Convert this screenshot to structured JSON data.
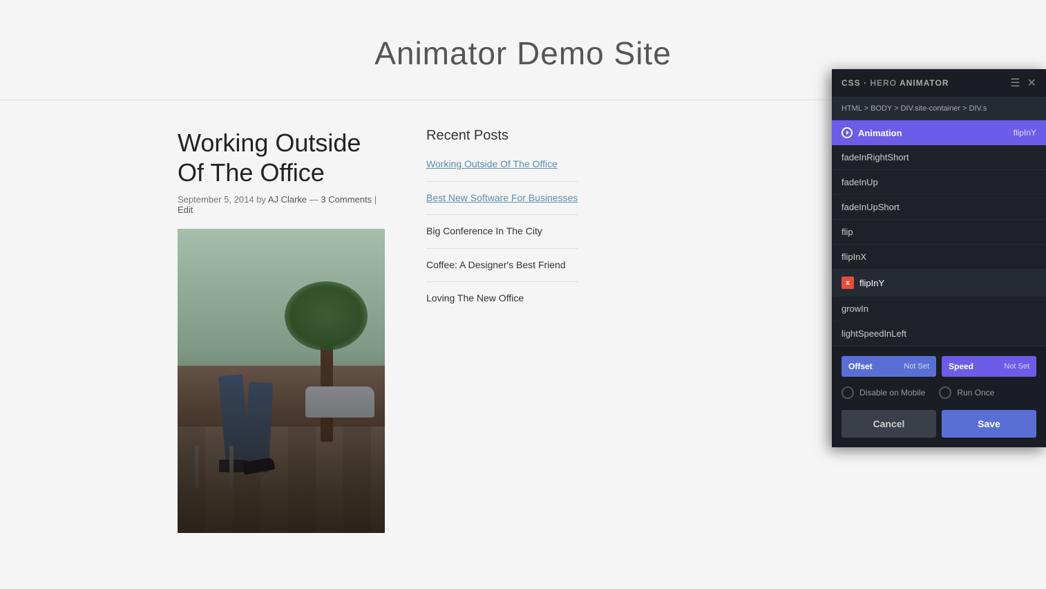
{
  "site": {
    "title": "Animator Demo Site"
  },
  "post": {
    "title": "Working Outside Of The Office",
    "meta": "September 5, 2014 by AJ Clarke — 3 Comments | Edit"
  },
  "sidebar": {
    "title": "Recent Posts",
    "posts": [
      {
        "label": "Working Outside Of The Office",
        "linked": true
      },
      {
        "label": "Best New Software For Businesses",
        "linked": true
      },
      {
        "label": "Big Conference In The City",
        "linked": false
      },
      {
        "label": "Coffee: A Designer's Best Friend",
        "linked": false
      },
      {
        "label": "Loving The New Office",
        "linked": false
      }
    ]
  },
  "animator_panel": {
    "title_css": "CSS",
    "title_separator": "·",
    "title_hero": "HERO",
    "title_animator": "ANIMATOR",
    "breadcrumb": "HTML > BODY > DIV.site-container > DIV.s",
    "animation_section_label": "Animation",
    "animation_current_value": "flipInY",
    "animation_items": [
      {
        "label": "fadeInRightShort",
        "active": false,
        "selected": false
      },
      {
        "label": "fadeInUp",
        "active": false,
        "selected": false
      },
      {
        "label": "fadeInUpShort",
        "active": false,
        "selected": false
      },
      {
        "label": "flip",
        "active": false,
        "selected": false
      },
      {
        "label": "flipInX",
        "active": false,
        "selected": false
      },
      {
        "label": "flipInY",
        "active": true,
        "selected": true
      },
      {
        "label": "growIn",
        "active": false,
        "selected": false
      },
      {
        "label": "lightSpeedInLeft",
        "active": false,
        "selected": false
      }
    ],
    "offset_label": "Offset",
    "offset_value": "Not Set",
    "speed_label": "Speed",
    "speed_value": "Not Set",
    "disable_mobile_label": "Disable on Mobile",
    "run_once_label": "Run Once",
    "cancel_label": "Cancel",
    "save_label": "Save"
  }
}
